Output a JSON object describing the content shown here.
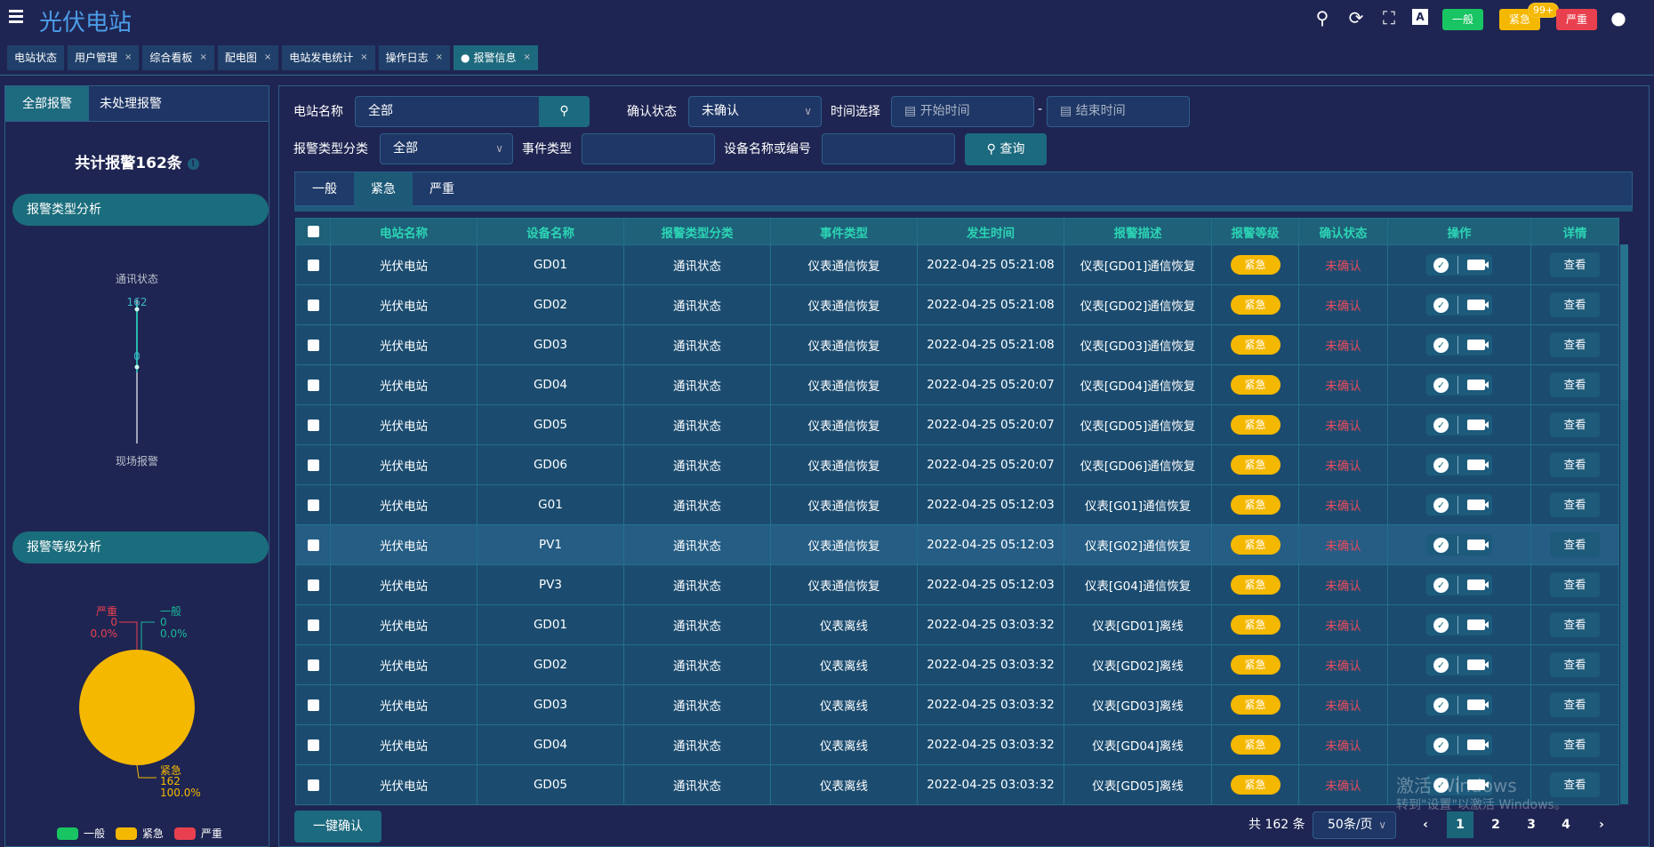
{
  "header": {
    "title": "光伏电站",
    "levels": [
      {
        "label": "一般",
        "color": "#19c463"
      },
      {
        "label": "紧急",
        "color": "#f5b800",
        "badge": "99+"
      },
      {
        "label": "严重",
        "color": "#e9404f"
      }
    ],
    "icons": [
      "menu-icon",
      "search-icon",
      "refresh-icon",
      "fullscreen-icon",
      "translate-icon",
      "user-icon"
    ]
  },
  "tabs": [
    {
      "label": "电站状态",
      "closable": false
    },
    {
      "label": "用户管理",
      "closable": true
    },
    {
      "label": "综合看板",
      "closable": true
    },
    {
      "label": "配电图",
      "closable": true
    },
    {
      "label": "电站发电统计",
      "closable": true
    },
    {
      "label": "操作日志",
      "closable": true
    },
    {
      "label": "报警信息",
      "closable": true,
      "active": true
    }
  ],
  "left": {
    "tabs": [
      "全部报警",
      "未处理报警"
    ],
    "total": "共计报警162条",
    "sec1": "报警类型分析",
    "sec2": "报警等级分析"
  },
  "chart_data": [
    {
      "type": "radar",
      "indicators": [
        "通讯状态",
        "现场报警"
      ],
      "values": [
        162,
        0
      ],
      "value_labels": [
        "162",
        "0"
      ]
    },
    {
      "type": "pie",
      "slices": [
        {
          "name": "一般",
          "value": 0,
          "percent": "0.0%",
          "color": "#19c463"
        },
        {
          "name": "紧急",
          "value": 162,
          "percent": "100.0%",
          "color": "#f5b800"
        },
        {
          "name": "严重",
          "value": 0,
          "percent": "0.0%",
          "color": "#e9404f"
        }
      ],
      "legend": "bottom"
    }
  ],
  "filters": {
    "station_label": "电站名称",
    "station_value": "全部",
    "confirm_label": "确认状态",
    "confirm_value": "未确认",
    "time_label": "时间选择",
    "start_ph": "开始时间",
    "end_ph": "结束时间",
    "sep": "-",
    "type_label": "报警类型分类",
    "type_value": "全部",
    "event_label": "事件类型",
    "device_label": "设备名称或编号",
    "query": "查询"
  },
  "level_tabs": [
    "一般",
    "紧急",
    "严重"
  ],
  "table": {
    "headers": [
      "电站名称",
      "设备名称",
      "报警类型分类",
      "事件类型",
      "发生时间",
      "报警描述",
      "报警等级",
      "确认状态",
      "操作",
      "详情"
    ],
    "rows": [
      [
        "光伏电站",
        "GD01",
        "通讯状态",
        "仪表通信恢复",
        "2022-04-25 05:21:08",
        "仪表[GD01]通信恢复",
        "紧急",
        "未确认",
        "查看"
      ],
      [
        "光伏电站",
        "GD02",
        "通讯状态",
        "仪表通信恢复",
        "2022-04-25 05:21:08",
        "仪表[GD02]通信恢复",
        "紧急",
        "未确认",
        "查看"
      ],
      [
        "光伏电站",
        "GD03",
        "通讯状态",
        "仪表通信恢复",
        "2022-04-25 05:21:08",
        "仪表[GD03]通信恢复",
        "紧急",
        "未确认",
        "查看"
      ],
      [
        "光伏电站",
        "GD04",
        "通讯状态",
        "仪表通信恢复",
        "2022-04-25 05:20:07",
        "仪表[GD04]通信恢复",
        "紧急",
        "未确认",
        "查看"
      ],
      [
        "光伏电站",
        "GD05",
        "通讯状态",
        "仪表通信恢复",
        "2022-04-25 05:20:07",
        "仪表[GD05]通信恢复",
        "紧急",
        "未确认",
        "查看"
      ],
      [
        "光伏电站",
        "GD06",
        "通讯状态",
        "仪表通信恢复",
        "2022-04-25 05:20:07",
        "仪表[GD06]通信恢复",
        "紧急",
        "未确认",
        "查看"
      ],
      [
        "光伏电站",
        "G01",
        "通讯状态",
        "仪表通信恢复",
        "2022-04-25 05:12:03",
        "仪表[G01]通信恢复",
        "紧急",
        "未确认",
        "查看"
      ],
      [
        "光伏电站",
        "PV1",
        "通讯状态",
        "仪表通信恢复",
        "2022-04-25 05:12:03",
        "仪表[G02]通信恢复",
        "紧急",
        "未确认",
        "查看"
      ],
      [
        "光伏电站",
        "PV3",
        "通讯状态",
        "仪表通信恢复",
        "2022-04-25 05:12:03",
        "仪表[G04]通信恢复",
        "紧急",
        "未确认",
        "查看"
      ],
      [
        "光伏电站",
        "GD01",
        "通讯状态",
        "仪表离线",
        "2022-04-25 03:03:32",
        "仪表[GD01]离线",
        "紧急",
        "未确认",
        "查看"
      ],
      [
        "光伏电站",
        "GD02",
        "通讯状态",
        "仪表离线",
        "2022-04-25 03:03:32",
        "仪表[GD02]离线",
        "紧急",
        "未确认",
        "查看"
      ],
      [
        "光伏电站",
        "GD03",
        "通讯状态",
        "仪表离线",
        "2022-04-25 03:03:32",
        "仪表[GD03]离线",
        "紧急",
        "未确认",
        "查看"
      ],
      [
        "光伏电站",
        "GD04",
        "通讯状态",
        "仪表离线",
        "2022-04-25 03:03:32",
        "仪表[GD04]离线",
        "紧急",
        "未确认",
        "查看"
      ],
      [
        "光伏电站",
        "GD05",
        "通讯状态",
        "仪表离线",
        "2022-04-25 03:03:32",
        "仪表[GD05]离线",
        "紧急",
        "未确认",
        "查看"
      ]
    ]
  },
  "footer": {
    "confirm_all": "一键确认",
    "total": "共 162 条",
    "page_size": "50条/页",
    "pages": [
      "1",
      "2",
      "3",
      "4"
    ],
    "current_page": "1",
    "prev": "‹",
    "next": "›"
  },
  "watermark": {
    "line1": "激活 Windows",
    "line2": "转到\"设置\"以激活 Windows。"
  }
}
